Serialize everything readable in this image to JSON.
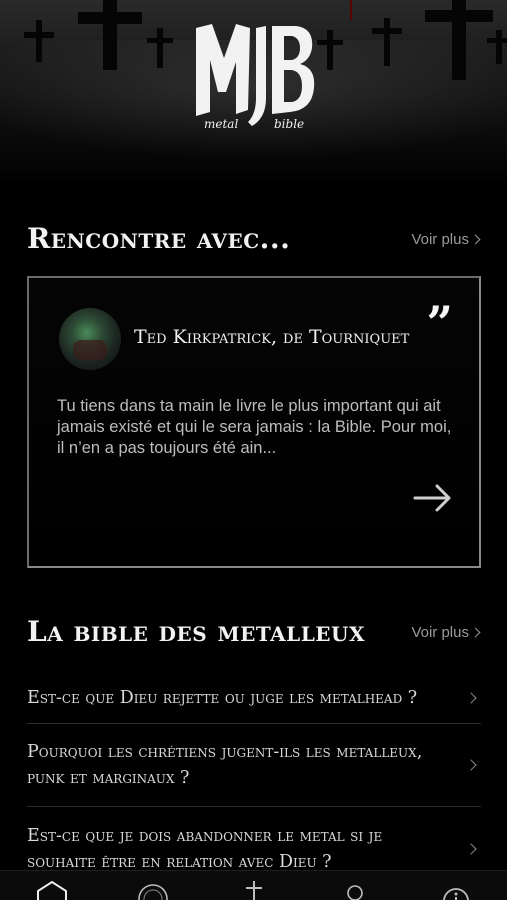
{
  "header": {
    "logo_alt": "MB",
    "logo_word_left": "metal",
    "logo_word_right": "bible"
  },
  "meet": {
    "title": "Rencontre avec...",
    "see_more": "Voir plus",
    "card": {
      "name": "Ted Kirkpatrick, de Tourniquet",
      "quote_mark": "”",
      "excerpt": "Tu tiens dans ta main le livre le plus important qui ait jamais existé et qui le sera jamais : la Bible. Pour moi, il n’en a pas toujours été ain..."
    }
  },
  "bible": {
    "title": "La bible des metalleux",
    "see_more": "Voir plus",
    "items": [
      {
        "label": "Est-ce que Dieu rejette ou juge les metalhead ?"
      },
      {
        "label": "Pourquoi les chrétiens jugent-ils les metalleux, punk et marginaux ?"
      },
      {
        "label": "Est-ce que je dois abandonner le metal si je souhaite être en relation avec Dieu ?"
      }
    ]
  },
  "tabbar": {
    "tabs": [
      {
        "icon": "home-icon"
      },
      {
        "icon": "radio-icon"
      },
      {
        "icon": "cross-icon"
      },
      {
        "icon": "circle-icon"
      },
      {
        "icon": "info-icon"
      }
    ]
  },
  "colors": {
    "background": "#000000",
    "text": "#e9e9e9",
    "muted": "#9a9a9a"
  }
}
